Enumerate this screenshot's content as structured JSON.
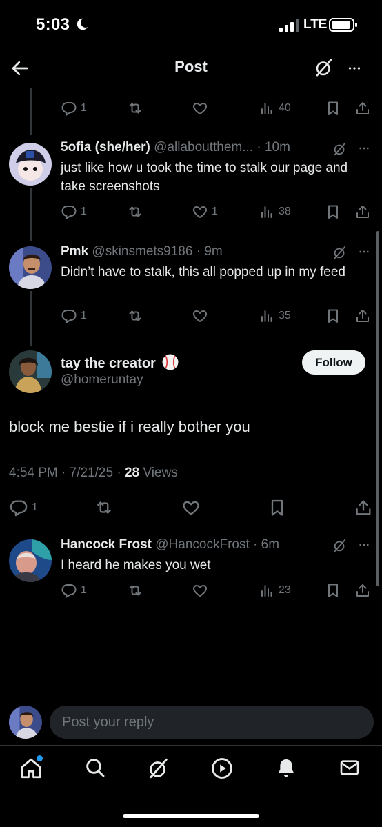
{
  "status_bar": {
    "time": "5:03",
    "network": "LTE"
  },
  "header": {
    "title": "Post"
  },
  "replies_above": [
    {
      "actions": {
        "reply": "1",
        "like": "",
        "views": "40"
      }
    },
    {
      "name": "5ofia (she/her)",
      "handle": "@allaboutthem...",
      "time": "10m",
      "text": "just like how u took the time to stalk our page and take screenshots",
      "actions": {
        "reply": "1",
        "like": "1",
        "views": "38"
      }
    },
    {
      "name": "Pmk",
      "handle": "@skinsmets9186",
      "time": "9m",
      "text": "Didn’t have to stalk, this all popped up in my feed",
      "actions": {
        "reply": "1",
        "like": "",
        "views": "35"
      }
    }
  ],
  "main_post": {
    "name": "tay the creator",
    "handle": "@homeruntay",
    "follow_label": "Follow",
    "text": "block me bestie if i really bother you",
    "time": "4:54 PM",
    "date": "7/21/25",
    "views_count": "28",
    "views_label": "Views",
    "reply_count": "1"
  },
  "replies_below": [
    {
      "name": "Hancock Frost",
      "handle": "@HancockFrost",
      "time": "6m",
      "text": "I heard he makes you wet",
      "actions": {
        "reply": "1",
        "like": "",
        "views": "23"
      }
    }
  ],
  "reply_bar": {
    "placeholder": "Post your reply"
  },
  "bottom_nav": [
    "home-icon",
    "search-icon",
    "grok-icon",
    "video-icon",
    "notifications-icon",
    "messages-icon"
  ],
  "colors": {
    "background": "#000000",
    "text": "#e7e9ea",
    "muted": "#71767b",
    "accent": "#1d9bf0"
  }
}
